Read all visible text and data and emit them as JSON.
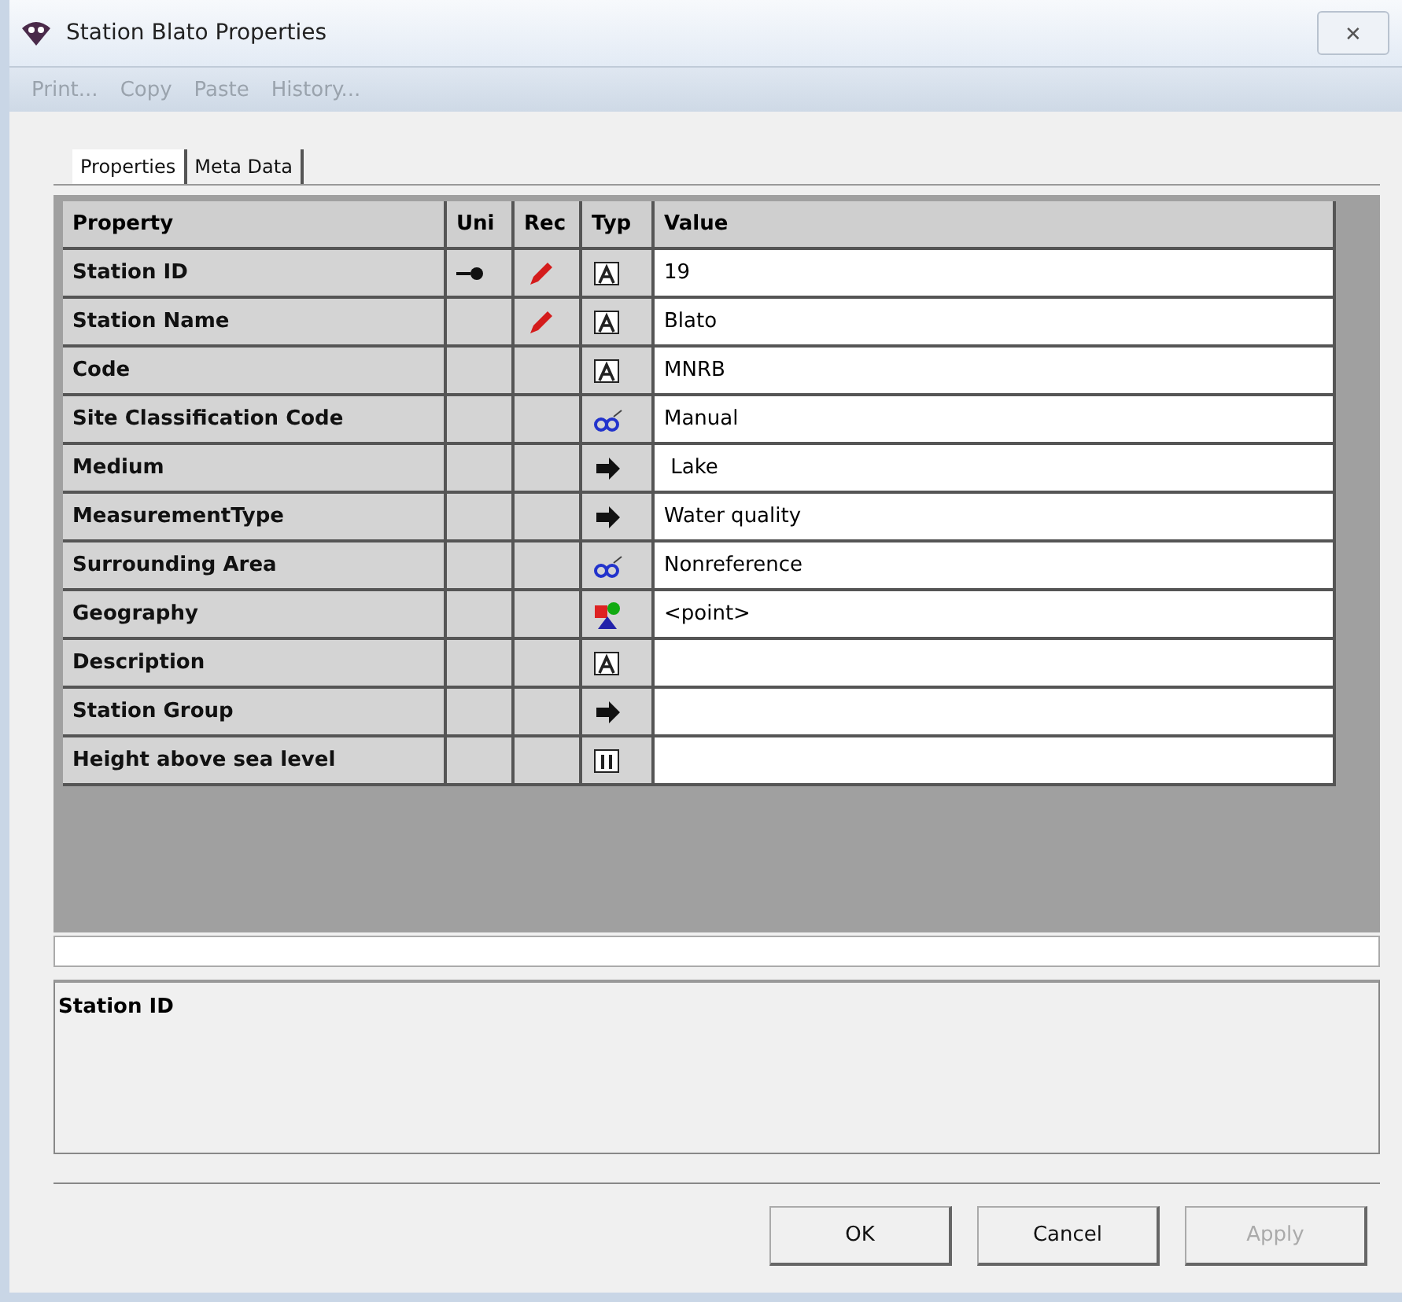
{
  "window": {
    "title": "Station Blato Properties",
    "close": "✕"
  },
  "menu": [
    {
      "label": "Print...",
      "disabled": true
    },
    {
      "label": "Copy",
      "disabled": true
    },
    {
      "label": "Paste",
      "disabled": true
    },
    {
      "label": "History...",
      "disabled": true
    }
  ],
  "tabs": [
    {
      "label": "Properties",
      "selected": true
    },
    {
      "label": "Meta Data",
      "selected": false
    }
  ],
  "table": {
    "columns": [
      "Property",
      "Uni",
      "Rec",
      "Typ",
      "Value"
    ],
    "rows": [
      {
        "property": "Station ID",
        "key": true,
        "required": true,
        "kind": "text",
        "value": "19"
      },
      {
        "property": "Station Name",
        "key": false,
        "required": true,
        "kind": "text",
        "value": "Blato"
      },
      {
        "property": "Code",
        "key": false,
        "required": false,
        "kind": "text",
        "value": "MNRB"
      },
      {
        "property": "Site Classification Code",
        "key": false,
        "required": false,
        "kind": "list",
        "value": "Manual"
      },
      {
        "property": "Medium",
        "key": false,
        "required": false,
        "kind": "link",
        "value": " Lake"
      },
      {
        "property": "MeasurementType",
        "key": false,
        "required": false,
        "kind": "link",
        "value": "Water quality"
      },
      {
        "property": "Surrounding Area",
        "key": false,
        "required": false,
        "kind": "list",
        "value": "Nonreference"
      },
      {
        "property": "Geography",
        "key": false,
        "required": false,
        "kind": "geo",
        "value": "<point>"
      },
      {
        "property": "Description",
        "key": false,
        "required": false,
        "kind": "text"
      },
      {
        "property": "Station Group",
        "key": false,
        "required": false,
        "kind": "link"
      },
      {
        "property": "Height above sea level",
        "key": false,
        "required": false,
        "kind": "number"
      }
    ]
  },
  "description": {
    "title": "Station ID"
  },
  "buttons": [
    {
      "label": "OK",
      "disabled": false
    },
    {
      "label": "Cancel",
      "disabled": false
    },
    {
      "label": "Apply",
      "disabled": true
    }
  ]
}
